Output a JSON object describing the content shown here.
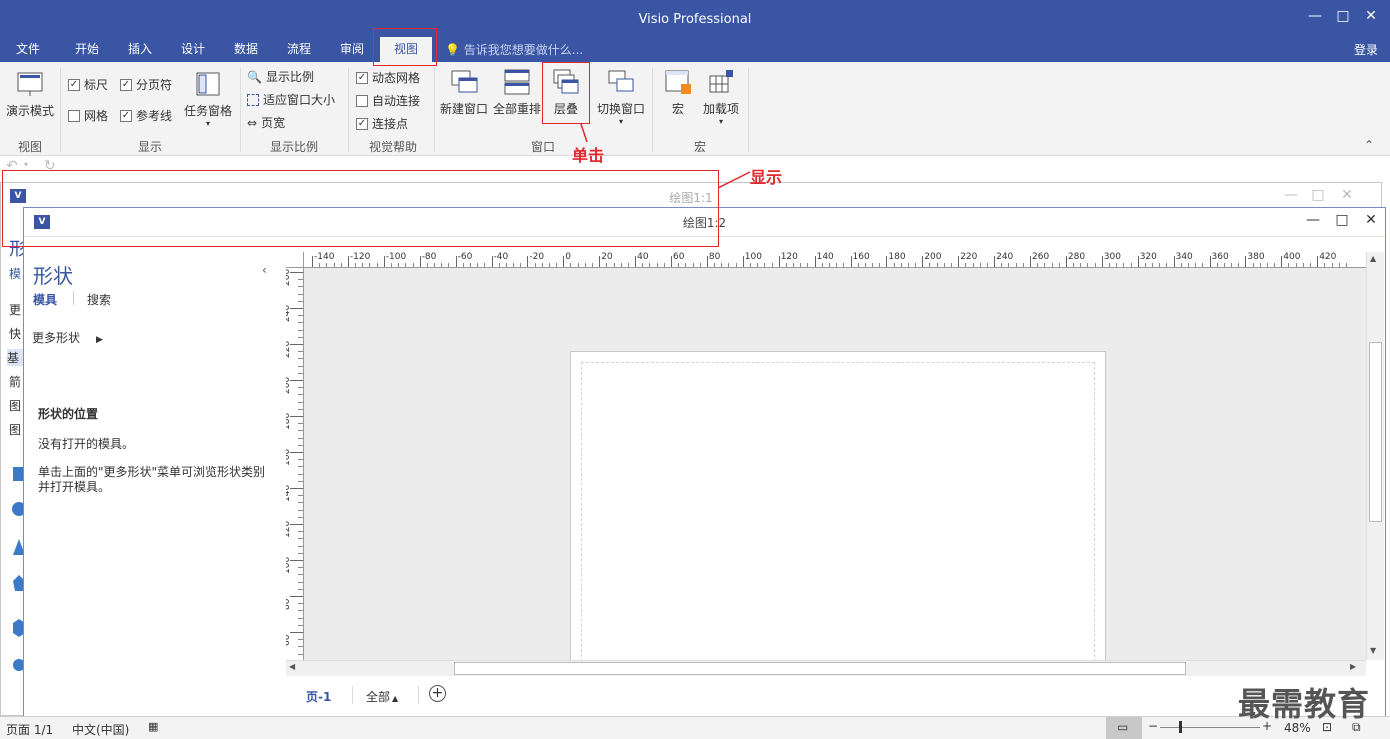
{
  "app_title": "Visio Professional",
  "window_controls": {
    "minimize": "—",
    "restore": "□",
    "close": "✕"
  },
  "tabs": [
    {
      "label": "文件"
    },
    {
      "label": "开始"
    },
    {
      "label": "插入"
    },
    {
      "label": "设计"
    },
    {
      "label": "数据"
    },
    {
      "label": "流程"
    },
    {
      "label": "审阅"
    },
    {
      "label": "视图"
    }
  ],
  "tell_me": "告诉我您想要做什么...",
  "login": "登录",
  "ribbon": {
    "presentation_mode": "演示模式",
    "group_view": "视图",
    "show": {
      "ruler": "标尺",
      "page_break": "分页符",
      "grid": "网格",
      "guides": "参考线",
      "task_panes": "任务窗格",
      "group": "显示"
    },
    "zoom": {
      "zoom": "显示比例",
      "fit_to_window": "适应窗口大小",
      "page_width": "页宽",
      "group": "显示比例"
    },
    "visual_aids": {
      "dynamic_grid": "动态网格",
      "auto_connect": "自动连接",
      "connection_points": "连接点",
      "group": "视觉帮助"
    },
    "window": {
      "new_window": "新建窗口",
      "arrange_all": "全部重排",
      "cascade": "层叠",
      "switch_windows": "切换窗口",
      "group": "窗口"
    },
    "macros": {
      "macros": "宏",
      "addins": "加载项",
      "group": "宏"
    }
  },
  "annotations": {
    "click": "单击",
    "show": "显示"
  },
  "window1": {
    "title": "绘图1:1"
  },
  "window2": {
    "title": "绘图1:2"
  },
  "shapes_panel": {
    "title": "形状",
    "tab_stencils": "模具",
    "tab_search": "搜索",
    "more_shapes": "更多形状",
    "location_heading": "形状的位置",
    "no_stencil": "没有打开的模具。",
    "hint": "单击上面的\"更多形状\"菜单可浏览形状类别并打开模具。"
  },
  "left_peek": [
    "形",
    "模",
    "更",
    "快",
    "基",
    "箭",
    "图",
    "图"
  ],
  "ruler_h": [
    "-140",
    "-120",
    "-100",
    "-80",
    "-60",
    "-40",
    "-20",
    "0",
    "20",
    "40",
    "60",
    "80",
    "100",
    "120",
    "140",
    "160",
    "180",
    "200",
    "220",
    "240",
    "260",
    "280",
    "300",
    "320",
    "340",
    "360",
    "380",
    "400",
    "420"
  ],
  "ruler_v": [
    "260",
    "240",
    "220",
    "200",
    "180",
    "160",
    "140",
    "120",
    "100",
    "80",
    "60"
  ],
  "page_tabs": {
    "current": "页-1",
    "all": "全部",
    "add": "+"
  },
  "status": {
    "page": "页面 1/1",
    "language": "中文(中国)",
    "zoom": "48%"
  },
  "watermark": "最需教育",
  "colors": {
    "accent": "#3955a3",
    "annotation": "#e0282e"
  }
}
